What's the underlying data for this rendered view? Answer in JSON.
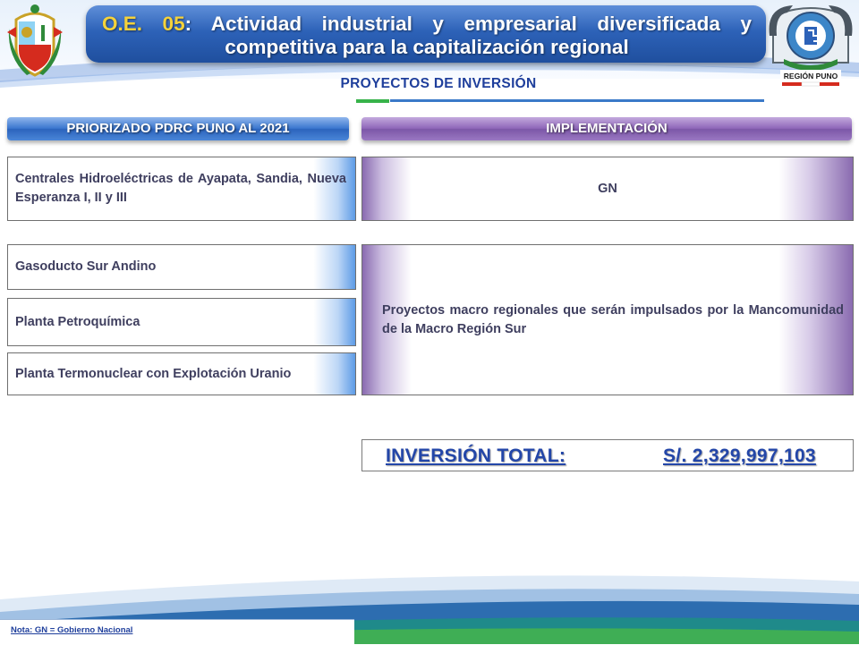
{
  "header": {
    "title_code": "O.E. 05",
    "title_sep": ":",
    "title_text": " Actividad industrial y empresarial diversificada y competitiva para la capitalización regional",
    "subtitle": "PROYECTOS DE INVERSIÓN",
    "logo_text": "REGIÓN PUNO"
  },
  "columns": {
    "left_header": "PRIORIZADO  PDRC PUNO AL 2021",
    "right_header": "IMPLEMENTACIÓN"
  },
  "projects": [
    "Centrales Hidroeléctricas de Ayapata, Sandia, Nueva Esperanza I, II y III",
    "Gasoducto Sur Andino",
    "Planta Petroquímica",
    "Planta Termonuclear con Explotación Uranio"
  ],
  "implementation": {
    "first": "GN",
    "second": "Proyectos macro regionales que serán impulsados por la Mancomunidad de la Macro Región Sur"
  },
  "total": {
    "label": "INVERSIÓN TOTAL:",
    "value": "S/. 2,329,997,103"
  },
  "note": "Nota: GN = Gobierno Nacional",
  "colors": {
    "title_bar": "#2d62b8",
    "title_code": "#f5d23a",
    "left_pill": "#3b77cf",
    "right_pill": "#8f67b9",
    "total_text": "#2346a8",
    "footer_teal": "#2c8a9a"
  },
  "icons": {
    "left_logo": "peru-coat-of-arms-icon",
    "right_logo": "region-puno-logo-icon"
  }
}
